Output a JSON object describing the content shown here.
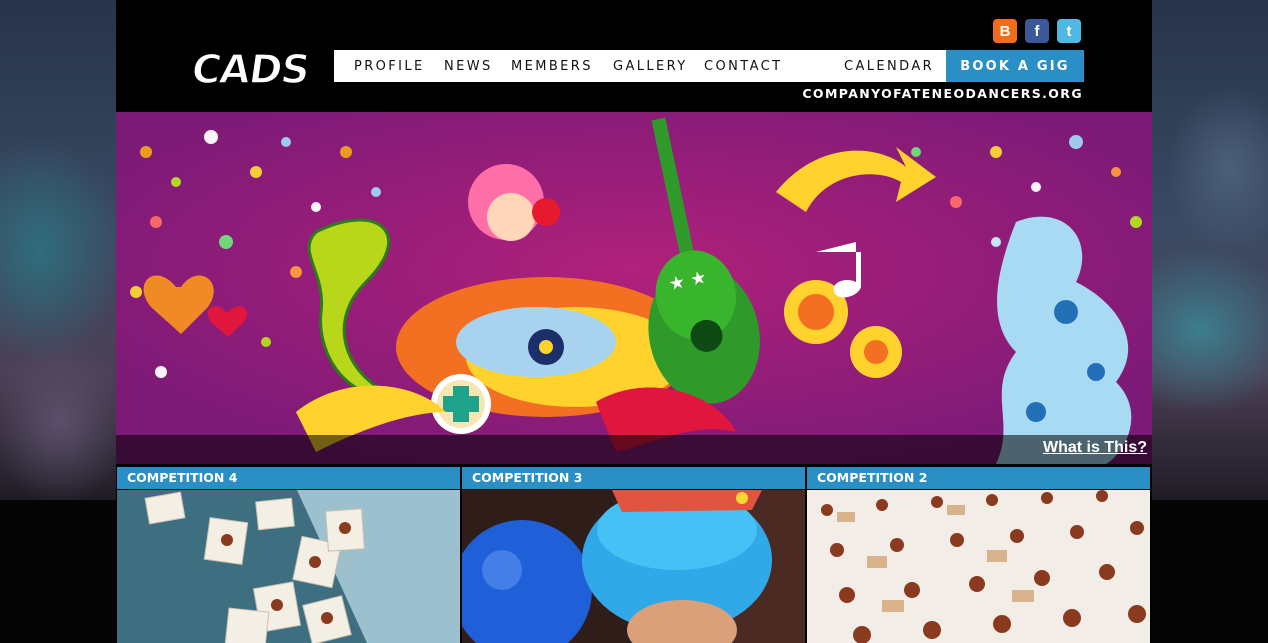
{
  "brand": {
    "logo_text": "CADS",
    "site_url": "COMPANYOFATENEODANCERS.ORG"
  },
  "social": [
    {
      "name": "blogger-icon",
      "glyph": "B",
      "color": "#f26c1a"
    },
    {
      "name": "facebook-icon",
      "glyph": "f",
      "color": "#3b5998"
    },
    {
      "name": "twitter-icon",
      "glyph": "t",
      "color": "#4fb8e4"
    }
  ],
  "nav": {
    "items": [
      "PROFILE",
      "NEWS",
      "MEMBERS",
      "GALLERY",
      "CONTACT",
      "CALENDAR"
    ],
    "book_label": "BOOK A GIG"
  },
  "hero": {
    "link_label": "What is This?"
  },
  "cards": [
    {
      "title": "COMPETITION 4"
    },
    {
      "title": "COMPETITION 3"
    },
    {
      "title": "COMPETITION 2"
    }
  ],
  "colors": {
    "accent": "#2a8fc4",
    "hero_bg": "#8d1e7a"
  }
}
